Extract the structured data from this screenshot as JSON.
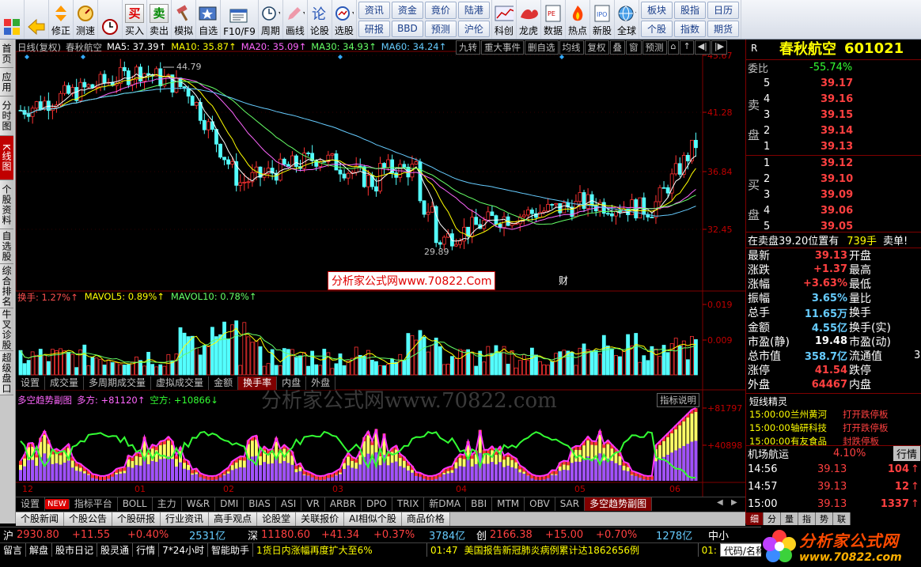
{
  "toolbar": {
    "left": [
      {
        "label": "",
        "icon": "tiles-icon"
      },
      {
        "label": "",
        "icon": "back-arrow-icon"
      },
      {
        "label": "修正",
        "icon": "up-down-arrows-icon"
      },
      {
        "label": "测速",
        "icon": "speed-test-icon"
      },
      {
        "label": "",
        "icon": "clock-icon"
      },
      {
        "label": "买入",
        "icon": "buy-icon",
        "glyph": "买"
      },
      {
        "label": "卖出",
        "icon": "sell-icon",
        "glyph": "卖"
      },
      {
        "label": "模拟",
        "icon": "hammer-icon"
      },
      {
        "label": "自选",
        "icon": "star-window-icon"
      },
      {
        "label": "F10/F9",
        "icon": "f10-icon"
      },
      {
        "label": "周期",
        "icon": "period-icon"
      },
      {
        "label": "画线",
        "icon": "pencil-icon"
      },
      {
        "label": "论股",
        "icon": "discussion-icon"
      },
      {
        "label": "选股",
        "icon": "stock-picker-icon"
      }
    ],
    "grid": [
      [
        "资讯",
        "研报"
      ],
      [
        "资金",
        "BBD"
      ],
      [
        "竟价",
        "预测"
      ],
      [
        "陆港",
        "沪伦"
      ]
    ],
    "right": [
      {
        "label": "科创",
        "icon": "kechuang-icon"
      },
      {
        "label": "龙虎",
        "icon": "dragon-tiger-icon"
      },
      {
        "label": "数据",
        "icon": "data-icon"
      },
      {
        "label": "热点",
        "icon": "hot-icon"
      },
      {
        "label": "新股",
        "icon": "new-stock-icon"
      },
      {
        "label": "全球",
        "icon": "globe-icon"
      }
    ],
    "grid_right": [
      [
        "板块",
        "个股"
      ],
      [
        "股指",
        "指数"
      ],
      [
        "日历",
        "期货"
      ]
    ]
  },
  "left_tabs": [
    "首页",
    "应用",
    "分时图",
    "K线图",
    "个股资料",
    "自选股",
    "综合排名",
    "牛叉诊股",
    "超级盘口"
  ],
  "active_left_tab": "K线图",
  "chart": {
    "header": [
      {
        "t": "日线(复权)",
        "c": "#c0c0c0"
      },
      {
        "t": "春秋航空",
        "c": "#c0c0c0"
      },
      {
        "t": "MA5: 37.39↑",
        "c": "#ffffff"
      },
      {
        "t": "MA10: 35.87↑",
        "c": "#ffff00"
      },
      {
        "t": "MA20: 35.09↑",
        "c": "#ff66ff"
      },
      {
        "t": "MA30: 34.93↑",
        "c": "#66ff66"
      },
      {
        "t": "MA60: 34.24↑",
        "c": "#66ccff"
      }
    ],
    "menu": [
      "九转",
      "重大事件",
      "删自选",
      "均线",
      "复权",
      "叠",
      "窗",
      "预测"
    ],
    "high_label": "44.79",
    "low_label": "29.89",
    "cai_label": "财",
    "y_labels": [
      "45.67",
      "41.28",
      "36.84",
      "32.45"
    ],
    "watermark_red": "分析家公式网www.70822.Com",
    "vol_header": [
      {
        "t": "换手: 1.27%↑",
        "c": "#ff5050"
      },
      {
        "t": "MAVOL5: 0.89%↑",
        "c": "#ffff00"
      },
      {
        "t": "MAVOL10: 0.78%↑",
        "c": "#66ff66"
      }
    ],
    "vol_labels": [
      "0.019",
      "0.009"
    ],
    "vol_tabs": [
      "设置",
      "成交量",
      "多周期成交量",
      "虚拟成交量",
      "金额",
      "换手率",
      "内盘",
      "外盘"
    ],
    "vol_tab_active": "换手率",
    "ind_header": [
      {
        "t": "多空趋势副图",
        "c": "#ff66ff"
      },
      {
        "t": "多方: +81120↑",
        "c": "#ff66ff"
      },
      {
        "t": "空方: +10866↓",
        "c": "#33ff33"
      }
    ],
    "ind_button": "指标说明",
    "ind_labels": [
      "+81797",
      "+40898"
    ],
    "gray_watermark": "分析家公式网www.70822.com",
    "months": [
      "12",
      "01",
      "02",
      "03",
      "04",
      "05",
      "06"
    ],
    "bottom_tabs": [
      "设置",
      "NEW",
      "指标平台",
      "BOLL",
      "主力",
      "W&R",
      "DMI",
      "BIAS",
      "ASI",
      "VR",
      "ARBR",
      "DPO",
      "TRIX",
      "新DMA",
      "BBI",
      "MTM",
      "OBV",
      "SAR",
      "多空趋势副图"
    ],
    "bottom_tab_active": "多空趋势副图"
  },
  "info_tabs": [
    "个股新闻",
    "个股公告",
    "个股研报",
    "行业资讯",
    "高手观点",
    "论股堂",
    "关联报价",
    "AI相似个股",
    "商品价格"
  ],
  "quote": {
    "r": "R",
    "name": "春秋航空",
    "code": "601021",
    "weibi_label": "委比",
    "weibi": "-55.74%",
    "sell_label": [
      "卖",
      "盘"
    ],
    "buy_label": [
      "买",
      "盘"
    ],
    "sells": [
      {
        "n": "5",
        "p": "39.17"
      },
      {
        "n": "4",
        "p": "39.16"
      },
      {
        "n": "3",
        "p": "39.15"
      },
      {
        "n": "2",
        "p": "39.14"
      },
      {
        "n": "1",
        "p": "39.13"
      }
    ],
    "buys": [
      {
        "n": "1",
        "p": "39.12"
      },
      {
        "n": "2",
        "p": "39.10"
      },
      {
        "n": "3",
        "p": "39.09"
      },
      {
        "n": "4",
        "p": "39.06"
      },
      {
        "n": "5",
        "p": "39.05"
      }
    ],
    "notice_a": "在卖盘39.20位置有",
    "notice_b": "739手",
    "notice_c": "卖单!",
    "stats": [
      {
        "l": "最新",
        "v": "39.13",
        "c": "#ff4040",
        "r": "开盘"
      },
      {
        "l": "涨跌",
        "v": "+1.37",
        "c": "#ff4040",
        "r": "最高"
      },
      {
        "l": "涨幅",
        "v": "+3.63%",
        "c": "#ff4040",
        "r": "最低"
      },
      {
        "l": "振幅",
        "v": "3.65%",
        "c": "#66ccff",
        "r": "量比"
      },
      {
        "l": "总手",
        "v": "11.65万",
        "c": "#66ccff",
        "r": "换手"
      },
      {
        "l": "金额",
        "v": "4.55亿",
        "c": "#66ccff",
        "r": "换手(实)"
      },
      {
        "l": "市盈(静)",
        "v": "19.48",
        "c": "#ffffff",
        "r": "市盈(动)"
      },
      {
        "l": "总市值",
        "v": "358.7亿",
        "c": "#66ccff",
        "r": "流通值"
      },
      {
        "l": "涨停",
        "v": "41.54",
        "c": "#ff4040",
        "r": "跌停"
      },
      {
        "l": "外盘",
        "v": "64467",
        "c": "#ff4040",
        "r": "内盘"
      }
    ],
    "stats_clipped": "3",
    "short_title": "短线精灵",
    "short": [
      {
        "t": "15:00:00",
        "s": "兰州黄河",
        "e": "打开跌停板"
      },
      {
        "t": "15:00:00",
        "s": "轴研科技",
        "e": "打开跌停板"
      },
      {
        "t": "15:00:00",
        "s": "有友食品",
        "e": "封跌停板"
      }
    ],
    "airport": "机场航运",
    "airport_pct": "4.10%",
    "hangqing": "行情",
    "ticks": [
      {
        "t": "14:56",
        "p": "39.13",
        "v": "104",
        "d": "↑"
      },
      {
        "t": "14:57",
        "p": "39.13",
        "v": "12",
        "d": "↑"
      },
      {
        "t": "15:00",
        "p": "39.13",
        "v": "1337",
        "d": "↑"
      }
    ],
    "side_tabs": [
      "细",
      "分",
      "量",
      "指",
      "势",
      "联"
    ]
  },
  "index_bar": {
    "sh_label": "沪",
    "sh": "2930.80",
    "sh_chg": "+11.55",
    "sh_pct": "+0.40%",
    "sh_amt": "2531亿",
    "sz_label": "深",
    "sz": "11180.60",
    "sz_chg": "+41.34",
    "sz_pct": "+0.37%",
    "sz_amt": "3784亿",
    "cy_label": "创",
    "cy": "2166.38",
    "cy_chg": "+15.00",
    "cy_pct": "+0.70%",
    "cy_amt": "1278亿",
    "zx": "中小"
  },
  "status_bar": {
    "items": [
      "留言",
      "解盘",
      "股市日记",
      "股灵通",
      "行情",
      "7*24小时",
      "智能助手"
    ],
    "news1": "1货日内涨幅再度扩大至6%",
    "time": "01:47",
    "news2": "美国报告新冠肺炎病例累计达1862656例",
    "time2": "01:",
    "code_label": "代码/名称"
  },
  "logo": {
    "text": "分析家公式网",
    "url": "www.70822.com"
  }
}
